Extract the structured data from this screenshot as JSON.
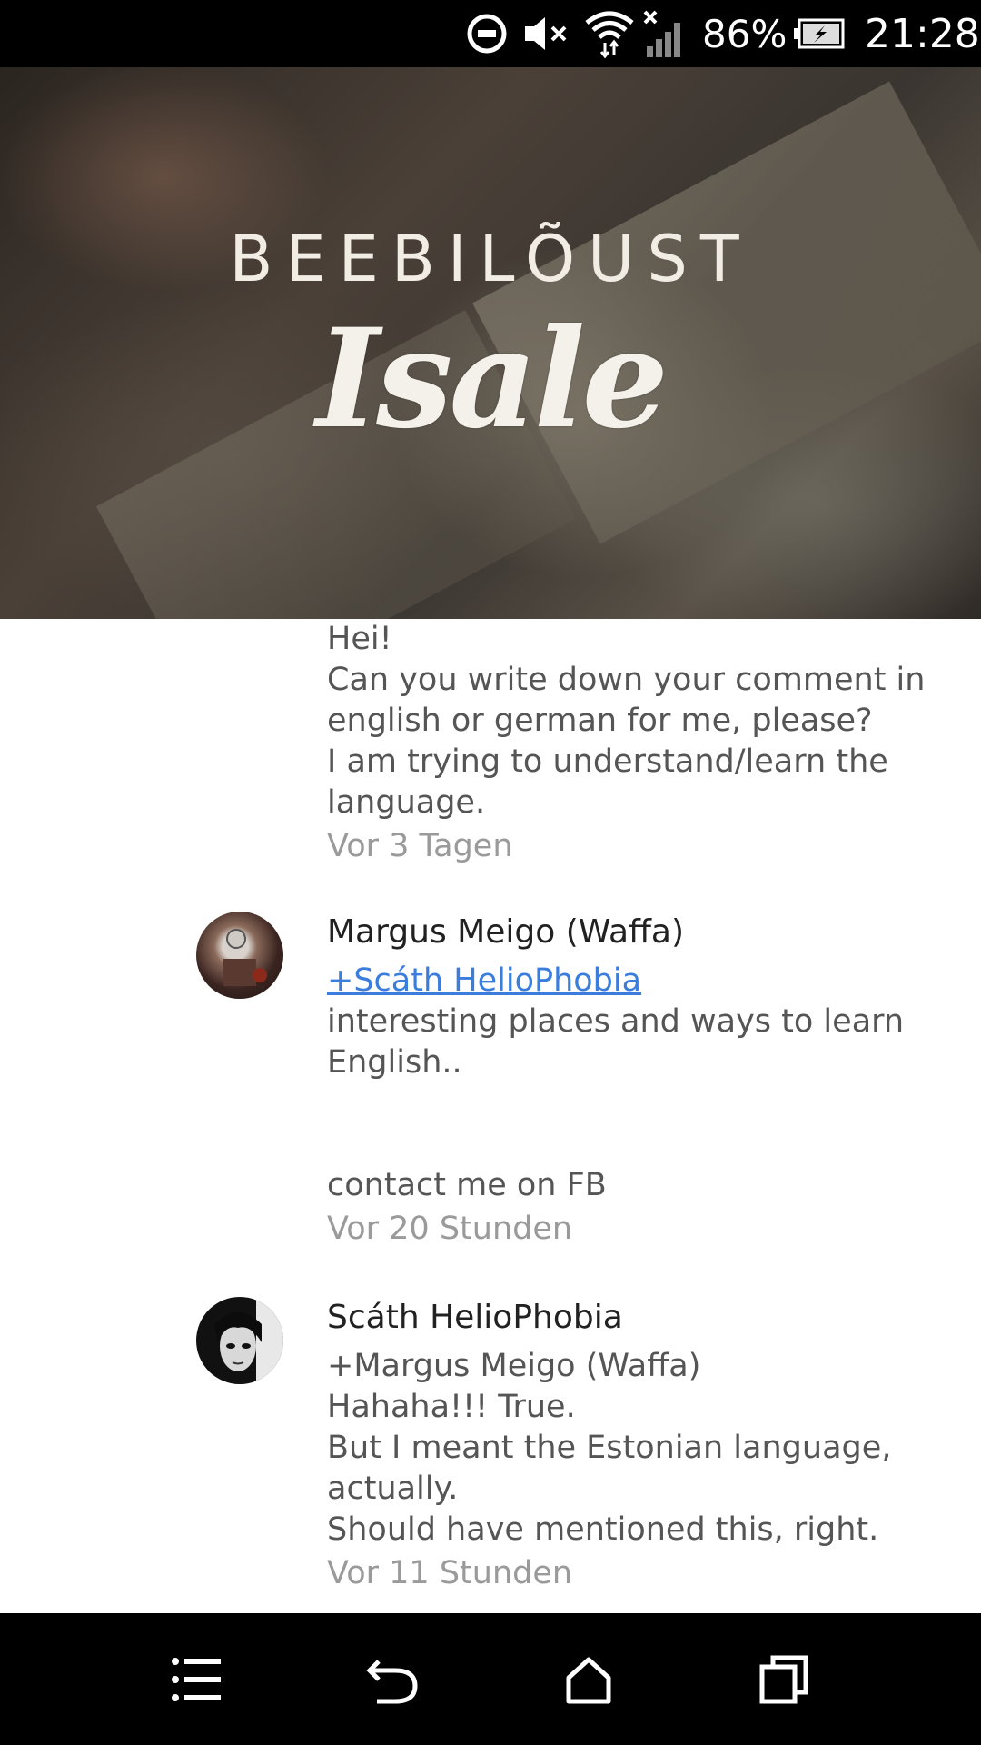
{
  "status_bar": {
    "battery": "86%",
    "time": "21:28",
    "icons": [
      "do-not-disturb-icon",
      "muted-icon",
      "wifi-icon",
      "signal-icon",
      "battery-icon"
    ]
  },
  "video": {
    "title": "BEEBILÕUST",
    "logo": "Isale"
  },
  "comments": [
    {
      "lines": [
        "Hei!",
        "Can you write down your comment in",
        "english or german for me, please?",
        "I am trying to understand/learn the",
        "language."
      ],
      "time": "Vor 3 Tagen"
    },
    {
      "author": "Margus Meigo (Waffa)",
      "mention": "+Scáth HelioPhobia",
      "lines": [
        "interesting places and ways to learn",
        "English.."
      ],
      "extra": "contact me on FB",
      "time": "Vor 20 Stunden"
    },
    {
      "author": "Scáth HelioPhobia",
      "lines": [
        "+Margus Meigo (Waffa)",
        "Hahaha!!! True.",
        "But I meant the Estonian language,",
        "actually.",
        "Should have mentioned this, right."
      ],
      "time": "Vor 11 Stunden"
    }
  ],
  "nav_bar": {
    "icons": [
      "menu-icon",
      "back-icon",
      "home-icon",
      "recents-icon"
    ]
  }
}
